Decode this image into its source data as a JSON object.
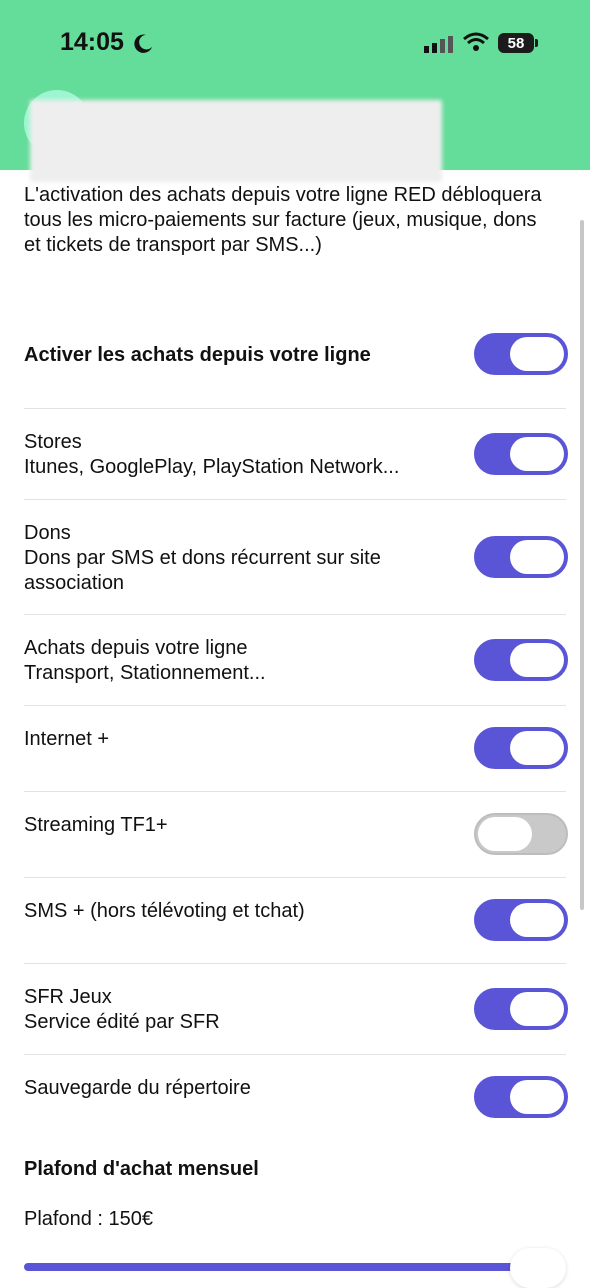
{
  "status_bar": {
    "time": "14:05",
    "battery": "58"
  },
  "intro_text": "L'activation des achats depuis votre ligne RED débloquera tous les micro-paiements sur facture (jeux, musique, dons et tickets de transport par SMS...)",
  "settings": [
    {
      "title": "Activer les achats depuis votre ligne",
      "subtitle": "",
      "enabled": true
    },
    {
      "title": "Stores",
      "subtitle": "Itunes, GooglePlay, PlayStation Network...",
      "enabled": true
    },
    {
      "title": "Dons",
      "subtitle": "Dons par SMS et dons récurrent sur site association",
      "enabled": true
    },
    {
      "title": "Achats depuis votre ligne",
      "subtitle": "Transport, Stationnement...",
      "enabled": true
    },
    {
      "title": "Internet +",
      "subtitle": "",
      "enabled": true
    },
    {
      "title": "Streaming TF1+",
      "subtitle": "",
      "enabled": false
    },
    {
      "title": "SMS + (hors télévoting et tchat)",
      "subtitle": "",
      "enabled": true
    },
    {
      "title": "SFR Jeux",
      "subtitle": "Service édité par SFR",
      "enabled": true
    },
    {
      "title": "Sauvegarde du répertoire",
      "subtitle": "",
      "enabled": true
    }
  ],
  "limit": {
    "section_title": "Plafond d'achat mensuel",
    "label": "Plafond : 150€",
    "slider_value_fraction": 0.98
  },
  "colors": {
    "header": "#64dc9a",
    "accent": "#5a55d6",
    "toggle_off": "#c9c9c9"
  }
}
